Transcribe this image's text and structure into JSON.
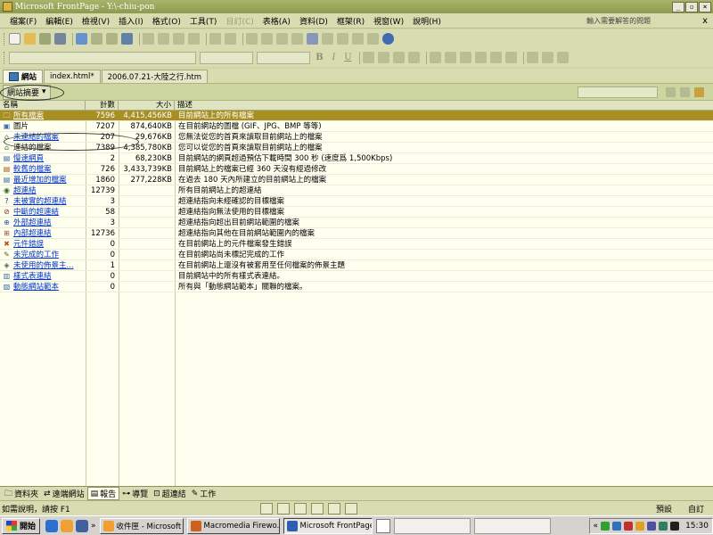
{
  "window": {
    "title": "Microsoft FrontPage - Y:\\-chiu-pon"
  },
  "menu": {
    "items": [
      "檔案(F)",
      "編輯(E)",
      "檢視(V)",
      "插入(I)",
      "格式(O)",
      "工具(T)",
      "目訂(C)",
      "表格(A)",
      "資料(D)",
      "框架(R)",
      "視窗(W)",
      "說明(H)"
    ],
    "ask_placeholder": "輸入需要解答的問題",
    "close": "x"
  },
  "format_toolbar": {
    "bold": "B",
    "italic": "I",
    "underline": "U"
  },
  "doc_tabs": [
    "網站",
    "index.html*",
    "2006.07.21-大陸之行.htm"
  ],
  "view": {
    "selector_label": "網站摘要"
  },
  "report": {
    "columns": [
      "名稱",
      "計數",
      "大小",
      "描述"
    ],
    "rows": [
      {
        "name": "所有檔案",
        "count": "7596",
        "size": "4,415,456KB",
        "desc": "目前網站上的所有檔案",
        "icon": "folder-icon",
        "link": true
      },
      {
        "name": "圖片",
        "count": "7207",
        "size": "874,640KB",
        "desc": "在目前網站的圖檔 (GIF、JPG、BMP 等等)",
        "icon": "picture-icon",
        "link": false
      },
      {
        "name": "未連結的檔案",
        "count": "207",
        "size": "29,676KB",
        "desc": "您無法從您的首頁來讀取目前網站上的檔案",
        "icon": "unlinked-icon",
        "link": true
      },
      {
        "name": "連結的檔案",
        "count": "7389",
        "size": "4,385,780KB",
        "desc": "您可以從您的首頁來讀取目前網站上的檔案",
        "icon": "linked-icon",
        "link": false
      },
      {
        "name": "慢速網頁",
        "count": "2",
        "size": "68,230KB",
        "desc": "目前網站的網頁超過預估下載時間 300 秒 (速度爲 1,500Kbps)",
        "icon": "slow-page-icon",
        "link": true
      },
      {
        "name": "較舊的檔案",
        "count": "726",
        "size": "3,433,739KB",
        "desc": "目前網站上的檔案已經 360 天沒有經過修改",
        "icon": "older-file-icon",
        "link": true
      },
      {
        "name": "最近增加的檔案",
        "count": "1860",
        "size": "277,228KB",
        "desc": "在過去 180 天內所建立的目前網站上的檔案",
        "icon": "new-file-icon",
        "link": true
      },
      {
        "name": "超連結",
        "count": "12739",
        "size": "",
        "desc": "所有目前網站上的超連結",
        "icon": "hyperlink-icon",
        "link": true
      },
      {
        "name": "未被實的超連結",
        "count": "3",
        "size": "",
        "desc": "超連結指向未經確認的目標檔案",
        "icon": "question-icon",
        "link": true
      },
      {
        "name": "中斷的超連結",
        "count": "58",
        "size": "",
        "desc": "超連結指向無法使用的目標檔案",
        "icon": "broken-link-icon",
        "link": true
      },
      {
        "name": "外部超連結",
        "count": "3",
        "size": "",
        "desc": "超連結指向超出目前網站範圍的檔案",
        "icon": "external-link-icon",
        "link": true
      },
      {
        "name": "內部超連結",
        "count": "12736",
        "size": "",
        "desc": "超連結指向其他在目前網站範圍內的檔案",
        "icon": "internal-link-icon",
        "link": true
      },
      {
        "name": "元件錯誤",
        "count": "0",
        "size": "",
        "desc": "在目前網站上的元件檔案發生錯誤",
        "icon": "component-error-icon",
        "link": true
      },
      {
        "name": "未完成的工作",
        "count": "0",
        "size": "",
        "desc": "在目前網站尚未標記完成的工作",
        "icon": "task-icon",
        "link": true
      },
      {
        "name": "未使用的佈景主...",
        "count": "1",
        "size": "",
        "desc": "在目前網站上還沒有被套用至任何檔案的佈景主題",
        "icon": "theme-icon",
        "link": true
      },
      {
        "name": "樣式表連結",
        "count": "0",
        "size": "",
        "desc": "目前網站中的所有樣式表連結。",
        "icon": "stylesheet-icon",
        "link": true
      },
      {
        "name": "動態網站範本",
        "count": "0",
        "size": "",
        "desc": "所有與「動態網站範本」關聯的檔案。",
        "icon": "template-icon",
        "link": true
      }
    ]
  },
  "view_tabs": [
    "資料夾",
    "遠端網站",
    "報告",
    "導覽",
    "超連結",
    "工作"
  ],
  "status": {
    "help": "如需說明，請按 F1",
    "mode": "預設",
    "view": "自訂"
  },
  "taskbar": {
    "start": "開始",
    "tasks": [
      "收件匣 - Microsoft ...",
      "Macromedia Firewo...",
      "Microsoft FrontPage..."
    ],
    "clock": "15:30"
  }
}
